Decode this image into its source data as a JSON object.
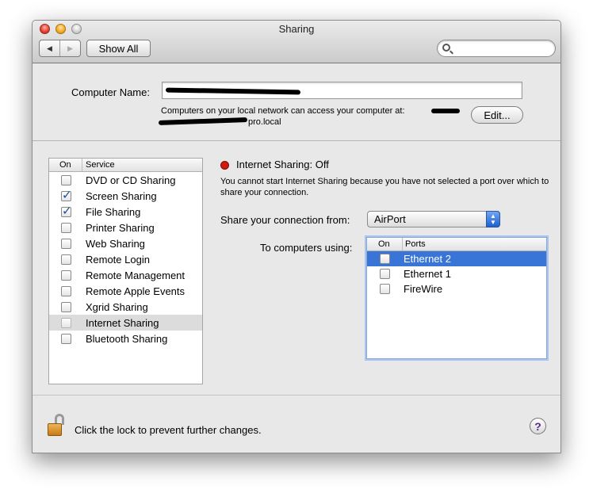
{
  "window": {
    "title": "Sharing"
  },
  "toolbar": {
    "back_icon": "◀",
    "forward_icon": "▶",
    "show_all_label": "Show All",
    "search_placeholder": ""
  },
  "computer": {
    "name_label": "Computer Name:",
    "name_value": "",
    "access_note_line1": "Computers on your local network can access your computer at:",
    "access_note_line2": "pro.local",
    "edit_label": "Edit..."
  },
  "services": {
    "header_on": "On",
    "header_service": "Service",
    "items": [
      {
        "label": "DVD or CD Sharing",
        "checked": false
      },
      {
        "label": "Screen Sharing",
        "checked": true
      },
      {
        "label": "File Sharing",
        "checked": true
      },
      {
        "label": "Printer Sharing",
        "checked": false
      },
      {
        "label": "Web Sharing",
        "checked": false
      },
      {
        "label": "Remote Login",
        "checked": false
      },
      {
        "label": "Remote Management",
        "checked": false
      },
      {
        "label": "Remote Apple Events",
        "checked": false
      },
      {
        "label": "Xgrid Sharing",
        "checked": false
      },
      {
        "label": "Internet Sharing",
        "checked": false,
        "selected": true
      },
      {
        "label": "Bluetooth Sharing",
        "checked": false
      }
    ]
  },
  "internet_sharing": {
    "status": "Internet Sharing: Off",
    "status_color": "#d11a0f",
    "description": "You cannot start Internet Sharing because you have not selected a port over which to share your connection.",
    "share_from_label": "Share your connection from:",
    "share_from_value": "AirPort",
    "to_computers_label": "To computers using:",
    "ports_header_on": "On",
    "ports_header_ports": "Ports",
    "ports": [
      {
        "label": "Ethernet 2",
        "checked": false,
        "selected": true
      },
      {
        "label": "Ethernet 1",
        "checked": false
      },
      {
        "label": "FireWire",
        "checked": false
      }
    ]
  },
  "footer": {
    "lock_text": "Click the lock to prevent further changes.",
    "help_label": "?"
  }
}
